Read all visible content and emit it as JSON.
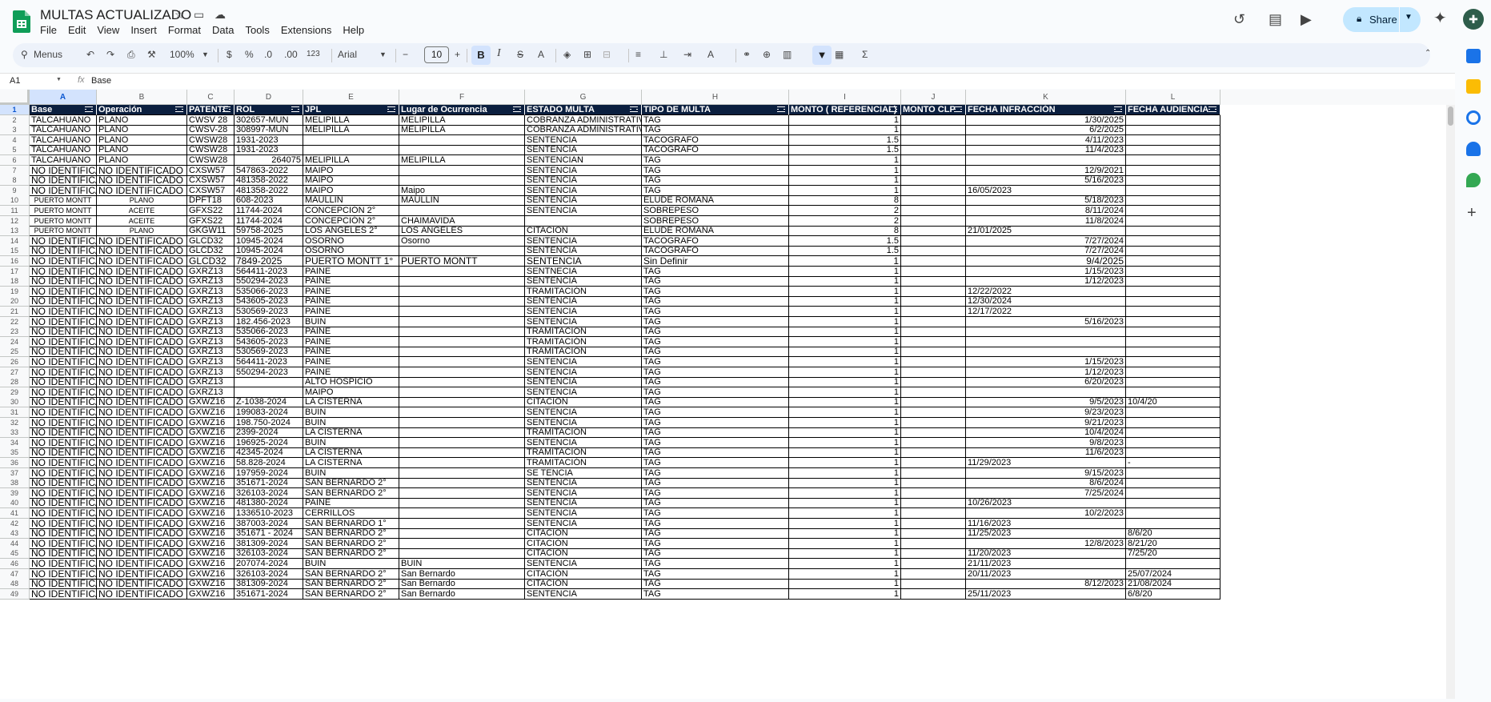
{
  "doc": {
    "title": "MULTAS ACTUALIZADO"
  },
  "menu": [
    "File",
    "Edit",
    "View",
    "Insert",
    "Format",
    "Data",
    "Tools",
    "Extensions",
    "Help"
  ],
  "share": {
    "label": "Share"
  },
  "toolbar": {
    "menus": "Menus",
    "zoom": "100%",
    "currency": "$",
    "percent": "%",
    "dec_less": ".0",
    "dec_more": ".00",
    "number_format": "123",
    "font": "Arial",
    "font_size": "10"
  },
  "formula_bar": {
    "cell_ref": "A1",
    "value": "Base"
  },
  "columns": [
    "A",
    "B",
    "C",
    "D",
    "E",
    "F",
    "G",
    "H",
    "I",
    "J",
    "K",
    "L"
  ],
  "header": {
    "row": "1",
    "cells": [
      "Base",
      "Operación",
      "PATENTE",
      "ROL",
      "JPL",
      "Lugar de Ocurrencia",
      "ESTADO MULTA",
      "TIPO DE MULTA",
      "MONTO ( REFERENCIAL)",
      "MONTO CLP",
      "FECHA INFRACCIÓN",
      "FECHA AUDIENCIA"
    ]
  },
  "rows": [
    [
      "2",
      "TALCAHUANO",
      "PLANO",
      "CWSV 28",
      "302657-MUN",
      "MELIPILLA",
      "MELIPILLA",
      "COBRANZA ADMINISTRATIVA",
      "TAG",
      "1",
      "",
      "1/30/2025",
      ""
    ],
    [
      "3",
      "TALCAHUANO",
      "PLANO",
      "CWSV-28",
      "308997-MUN",
      "MELIPILLA",
      "MELIPILLA",
      "COBRANZA ADMINISTRATIVA",
      "TAG",
      "1",
      "",
      "6/2/2025",
      ""
    ],
    [
      "4",
      "TALCAHUANO",
      "PLANO",
      "CWSW28",
      "1931-2023",
      "",
      "",
      "SENTENCIA",
      "TACOGRAFO",
      "1.5",
      "",
      "4/11/2023",
      ""
    ],
    [
      "5",
      "TALCAHUANO",
      "PLANO",
      "CWSW28",
      "1931-2023",
      "",
      "",
      "SENTENCIA",
      "TACOGRAFO",
      "1.5",
      "",
      "11/4/2023",
      ""
    ],
    [
      "6",
      "TALCAHUANO",
      "PLANO",
      "CWSW28",
      "264075",
      "MELIPILLA",
      "MELIPILLA",
      "SENTENCIAN",
      "TAG",
      "1",
      "",
      "",
      ""
    ],
    [
      "7",
      "NO IDENTIFICADO",
      "NO IDENTIFICADO",
      "CXSW57",
      "547863-2022",
      "MAIPO",
      "",
      "SENTENCIA",
      "TAG",
      "1",
      "",
      "12/9/2021",
      ""
    ],
    [
      "8",
      "NO IDENTIFICADO",
      "NO IDENTIFICADO",
      "CXSW57",
      "481358-2022",
      "MAIPO",
      "",
      "SENTENCIA",
      "TAG",
      "1",
      "",
      "5/16/2023",
      ""
    ],
    [
      "9",
      "NO IDENTIFICADO",
      "NO IDENTIFICADO",
      "CXSW57",
      "481358-2022",
      "MAIPO",
      "Maipo",
      "SENTENCIA",
      "TAG",
      "1",
      "",
      "16/05/2023",
      ""
    ],
    [
      "10",
      "PUERTO MONTT",
      "PLANO",
      "DPFT18",
      "608-2023",
      "MAULLIN",
      "MAULLIN",
      "SENTENCIA",
      "ELUDE ROMANA",
      "8",
      "",
      "5/18/2023",
      ""
    ],
    [
      "11",
      "PUERTO MONTT",
      "ACEITE",
      "GFXS22",
      "11744-2024",
      "CONCEPCIÓN 2°",
      "",
      "SENTENCIA",
      "SOBREPESO",
      "2",
      "",
      "8/11/2024",
      ""
    ],
    [
      "12",
      "PUERTO MONTT",
      "ACEITE",
      "GFXS22",
      "11744-2024",
      "CONCEPCIÓN 2°",
      "CHAIMAVIDA",
      "",
      "SOBREPESO",
      "2",
      "",
      "11/8/2024",
      ""
    ],
    [
      "13",
      "PUERTO MONTT",
      "PLANO",
      "GKGW11",
      "59758-2025",
      "LOS ÁNGELES 2°",
      "LOS ÁNGELES",
      "CITACIÓN",
      "ELUDE ROMANA",
      "8",
      "",
      "21/01/2025",
      ""
    ],
    [
      "14",
      "NO IDENTIFICADO",
      "NO IDENTIFICADO",
      "GLCD32",
      "10945-2024",
      "OSORNO",
      "Osorno",
      "SENTENCIA",
      "TACOGRAFO",
      "1.5",
      "",
      "7/27/2024",
      ""
    ],
    [
      "15",
      "NO IDENTIFICADO",
      "NO IDENTIFICADO",
      "GLCD32",
      "10945-2024",
      "OSORNO",
      "",
      "SENTENCIA",
      "TACOGRAFO",
      "1.5",
      "",
      "7/27/2024",
      ""
    ],
    [
      "16",
      "NO IDENTIFICADO",
      "NO IDENTIFICADO",
      "GLCD32",
      "7849-2025",
      "PUERTO MONTT 1°",
      "PUERTO MONTT",
      "SENTENCIA",
      "Sin Definir",
      "1",
      "",
      "9/4/2025",
      ""
    ],
    [
      "17",
      "NO IDENTIFICADO",
      "NO IDENTIFICADO",
      "GXRZ13",
      "564411-2023",
      "PAINE",
      "",
      "SENTNECIA",
      "TAG",
      "1",
      "",
      "1/15/2023",
      ""
    ],
    [
      "18",
      "NO IDENTIFICADO",
      "NO IDENTIFICADO",
      "GXRZ13",
      "550294-2023",
      "PAINE",
      "",
      "SENTENCIA",
      "TAG",
      "1",
      "",
      "1/12/2023",
      ""
    ],
    [
      "19",
      "NO IDENTIFICADO",
      "NO IDENTIFICADO",
      "GXRZ13",
      "535066-2023",
      "PAINE",
      "",
      "TRAMITACIÓN",
      "TAG",
      "1",
      "",
      "12/22/2022",
      ""
    ],
    [
      "20",
      "NO IDENTIFICADO",
      "NO IDENTIFICADO",
      "GXRZ13",
      "543605-2023",
      "PAINE",
      "",
      "SENTENCIA",
      "TAG",
      "1",
      "",
      "12/30/2024",
      ""
    ],
    [
      "21",
      "NO IDENTIFICADO",
      "NO IDENTIFICADO",
      "GXRZ13",
      "530569-2023",
      "PAINE",
      "",
      "SENTENCIA",
      "TAG",
      "1",
      "",
      "12/17/2022",
      ""
    ],
    [
      "22",
      "NO IDENTIFICADO",
      "NO IDENTIFICADO",
      "GXRZ13",
      "182.456-2023",
      "BUIN",
      "",
      "SENTENCIA",
      "TAG",
      "1",
      "",
      "5/16/2023",
      ""
    ],
    [
      "23",
      "NO IDENTIFICADO",
      "NO IDENTIFICADO",
      "GXRZ13",
      "535066-2023",
      "PAINE",
      "",
      "TRAMITACIÓN",
      "TAG",
      "1",
      "",
      "",
      ""
    ],
    [
      "24",
      "NO IDENTIFICADO",
      "NO IDENTIFICADO",
      "GXRZ13",
      "543605-2023",
      "PAINE",
      "",
      "TRAMITACIÓN",
      "TAG",
      "1",
      "",
      "",
      ""
    ],
    [
      "25",
      "NO IDENTIFICADO",
      "NO IDENTIFICADO",
      "GXRZ13",
      "530569-2023",
      "PAINE",
      "",
      "TRAMITACIÓN",
      "TAG",
      "1",
      "",
      "",
      ""
    ],
    [
      "26",
      "NO IDENTIFICADO",
      "NO IDENTIFICADO",
      "GXRZ13",
      "564411-2023",
      "PAINE",
      "",
      "SENTENCIA",
      "TAG",
      "1",
      "",
      "1/15/2023",
      ""
    ],
    [
      "27",
      "NO IDENTIFICADO",
      "NO IDENTIFICADO",
      "GXRZ13",
      "550294-2023",
      "PAINE",
      "",
      "SENTENCIA",
      "TAG",
      "1",
      "",
      "1/12/2023",
      ""
    ],
    [
      "28",
      "NO IDENTIFICADO",
      "NO IDENTIFICADO",
      "GXRZ13",
      "",
      "ALTO HOSPICIO",
      "",
      "SENTENCIA",
      "TAG",
      "1",
      "",
      "6/20/2023",
      ""
    ],
    [
      "29",
      "NO IDENTIFICADO",
      "NO IDENTIFICADO",
      "GXRZ13",
      "",
      "MAIPO",
      "",
      "SENTENCIA",
      "TAG",
      "1",
      "",
      "",
      ""
    ],
    [
      "30",
      "NO IDENTIFICADO",
      "NO IDENTIFICADO",
      "GXWZ16",
      "Z-1038-2024",
      "LA CISTERNA",
      "",
      "CITACIÓN",
      "TAG",
      "1",
      "",
      "9/5/2023",
      "10/4/20"
    ],
    [
      "31",
      "NO IDENTIFICADO",
      "NO IDENTIFICADO",
      "GXWZ16",
      "199083-2024",
      "BUIN",
      "",
      "SENTENCIA",
      "TAG",
      "1",
      "",
      "9/23/2023",
      ""
    ],
    [
      "32",
      "NO IDENTIFICADO",
      "NO IDENTIFICADO",
      "GXWZ16",
      "198.750-2024",
      "BUIN",
      "",
      "SENTENCIA",
      "TAG",
      "1",
      "",
      "9/21/2023",
      ""
    ],
    [
      "33",
      "NO IDENTIFICADO",
      "NO IDENTIFICADO",
      "GXWZ16",
      "2399-2024",
      "LA CISTERNA",
      "",
      "TRAMITACIÓN",
      "TAG",
      "1",
      "",
      "10/4/2024",
      ""
    ],
    [
      "34",
      "NO IDENTIFICADO",
      "NO IDENTIFICADO",
      "GXWZ16",
      "196925-2024",
      "BUIN",
      "",
      "SENTENCIA",
      "TAG",
      "1",
      "",
      "9/8/2023",
      ""
    ],
    [
      "35",
      "NO IDENTIFICADO",
      "NO IDENTIFICADO",
      "GXWZ16",
      "42345-2024",
      "LA CISTERNA",
      "",
      "TRAMITACIÓN",
      "TAG",
      "1",
      "",
      "11/6/2023",
      ""
    ],
    [
      "36",
      "NO IDENTIFICADO",
      "NO IDENTIFICADO",
      "GXWZ16",
      "58.828-2024",
      "LA CISTERNA",
      "",
      "TRAMITACIÓN",
      "TAG",
      "1",
      "",
      "11/29/2023",
      "-"
    ],
    [
      "37",
      "NO IDENTIFICADO",
      "NO IDENTIFICADO",
      "GXWZ16",
      "197959-2024",
      "BUIN",
      "",
      "SE TENCIA",
      "TAG",
      "1",
      "",
      "9/15/2023",
      ""
    ],
    [
      "38",
      "NO IDENTIFICADO",
      "NO IDENTIFICADO",
      "GXWZ16",
      "351671-2024",
      "SAN BERNARDO 2°",
      "",
      "SENTENCIA",
      "TAG",
      "1",
      "",
      "8/6/2024",
      ""
    ],
    [
      "39",
      "NO IDENTIFICADO",
      "NO IDENTIFICADO",
      "GXWZ16",
      "326103-2024",
      "SAN BERNARDO 2°",
      "",
      "SENTENCIA",
      "TAG",
      "1",
      "",
      "7/25/2024",
      ""
    ],
    [
      "40",
      "NO IDENTIFICADO",
      "NO IDENTIFICADO",
      "GXWZ16",
      "481380-2024",
      "PAINE",
      "",
      "SENTENCIA",
      "TAG",
      "1",
      "",
      "10/26/2023",
      ""
    ],
    [
      "41",
      "NO IDENTIFICADO",
      "NO IDENTIFICADO",
      "GXWZ16",
      "1336510-2023",
      "CERRILLOS",
      "",
      "SENTENCIA",
      "TAG",
      "1",
      "",
      "10/2/2023",
      ""
    ],
    [
      "42",
      "NO IDENTIFICADO",
      "NO IDENTIFICADO",
      "GXWZ16",
      "387003-2024",
      "SAN BERNARDO 1°",
      "",
      "SENTENCIA",
      "TAG",
      "1",
      "",
      "11/16/2023",
      ""
    ],
    [
      "43",
      "NO IDENTIFICADO",
      "NO IDENTIFICADO",
      "GXWZ16",
      "351671 - 2024",
      "SAN BERNARDO 2°",
      "",
      "CITACIÓN",
      "TAG",
      "1",
      "",
      "11/25/2023",
      "8/6/20"
    ],
    [
      "44",
      "NO IDENTIFICADO",
      "NO IDENTIFICADO",
      "GXWZ16",
      "381309-2024",
      "SAN BERNARDO 2°",
      "",
      "CITACIÓN",
      "TAG",
      "1",
      "",
      "12/8/2023",
      "8/21/20"
    ],
    [
      "45",
      "NO IDENTIFICADO",
      "NO IDENTIFICADO",
      "GXWZ16",
      "326103-2024",
      "SAN BERNARDO 2°",
      "",
      "CITACIÓN",
      "TAG",
      "1",
      "",
      "11/20/2023",
      "7/25/20"
    ],
    [
      "46",
      "NO IDENTIFICADO",
      "NO IDENTIFICADO",
      "GXWZ16",
      "207074-2024",
      "BUIN",
      "BUIN",
      "SENTENCIA",
      "TAG",
      "1",
      "",
      "21/11/2023",
      ""
    ],
    [
      "47",
      "NO IDENTIFICADO",
      "NO IDENTIFICADO",
      "GXWZ16",
      "326103-2024",
      "SAN BERNARDO 2°",
      "San Bernardo",
      "CITACIÓN",
      "TAG",
      "1",
      "",
      "20/11/2023",
      "25/07/2024"
    ],
    [
      "48",
      "NO IDENTIFICADO",
      "NO IDENTIFICADO",
      "GXWZ16",
      "381309-2024",
      "SAN BERNARDO 2°",
      "San Bernardo",
      "CITACIÓN",
      "TAG",
      "1",
      "",
      "8/12/2023",
      "21/08/2024"
    ],
    [
      "49",
      "NO IDENTIFICADO",
      "NO IDENTIFICADO",
      "GXWZ16",
      "351671-2024",
      "SAN BERNARDO 2°",
      "San Bernardo",
      "SENTENCIA",
      "TAG",
      "1",
      "",
      "25/11/2023",
      "6/8/20"
    ]
  ]
}
